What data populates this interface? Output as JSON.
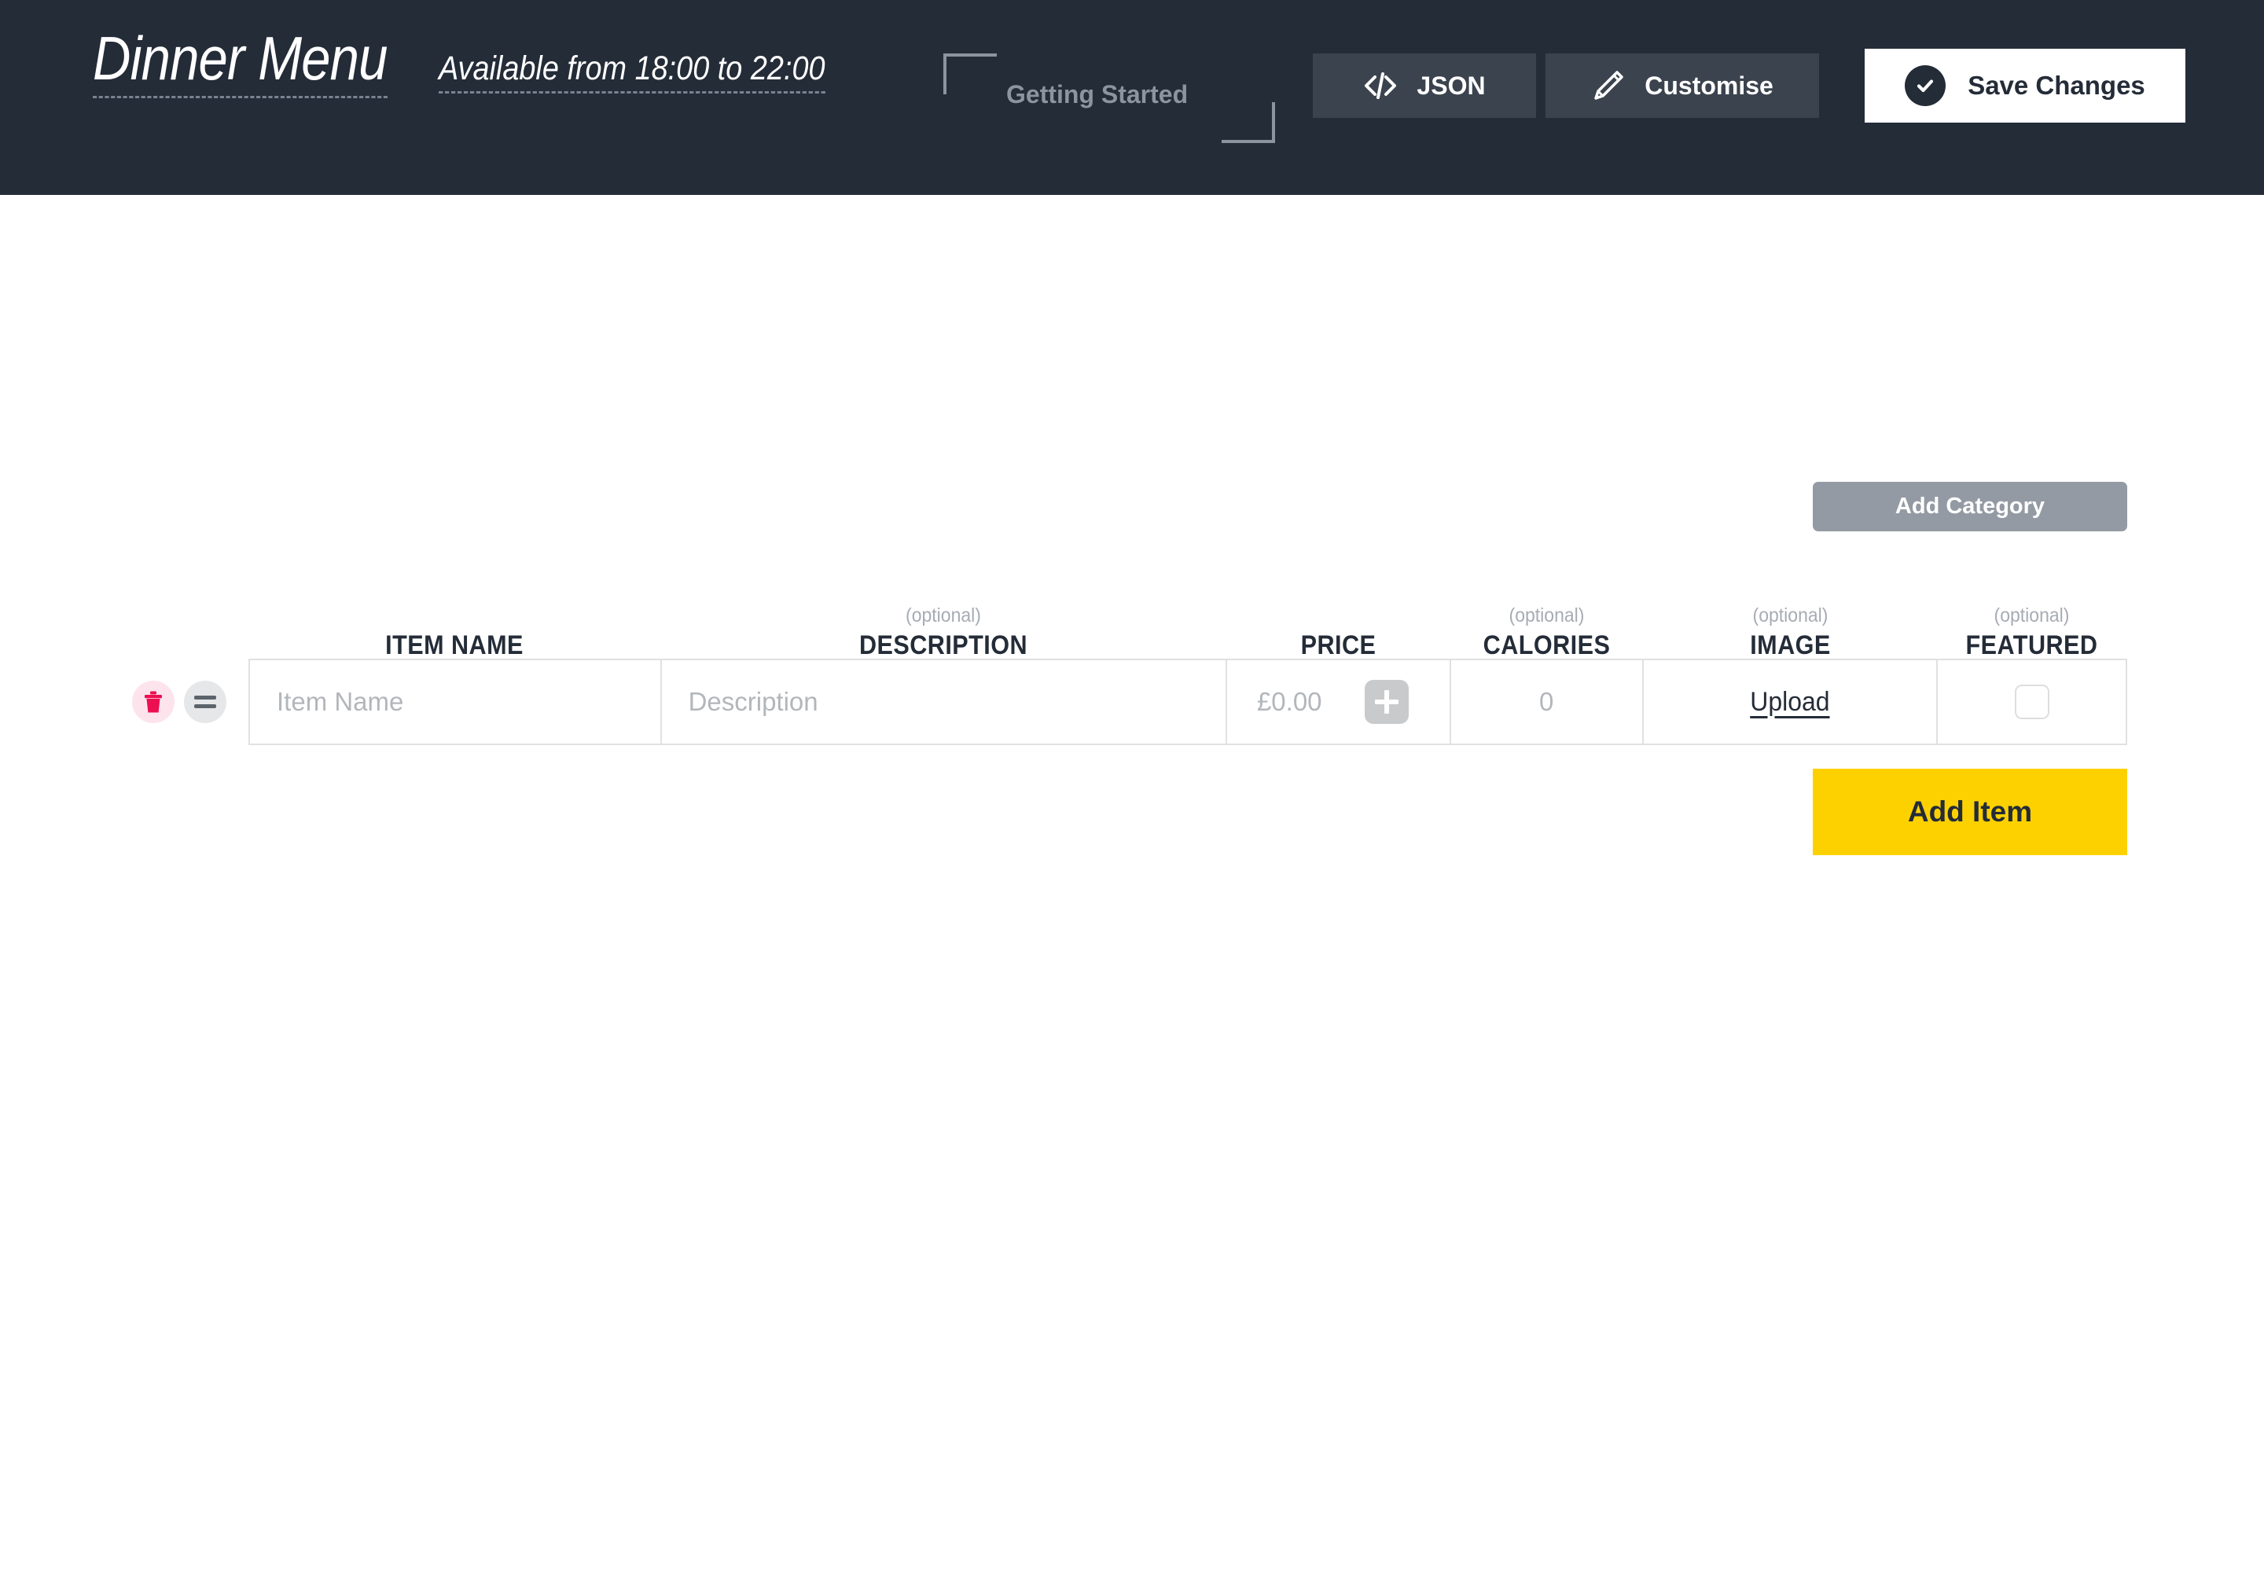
{
  "header": {
    "title": "Dinner Menu",
    "subtitle": "Available from 18:00 to 22:00",
    "getting_started_label": "Getting Started",
    "buttons": {
      "json": "JSON",
      "customise": "Customise",
      "save": "Save Changes"
    },
    "colors": {
      "background": "#242c38",
      "button_background": "#3b434e",
      "save_background": "#ffffff",
      "bracket": "#8c949f"
    }
  },
  "main": {
    "add_category_label": "Add Category",
    "add_item_label": "Add Item",
    "optional_tag": "(optional)",
    "columns": [
      {
        "label": "ITEM NAME",
        "optional": false
      },
      {
        "label": "DESCRIPTION",
        "optional": true
      },
      {
        "label": "PRICE",
        "optional": false
      },
      {
        "label": "CALORIES",
        "optional": true
      },
      {
        "label": "IMAGE",
        "optional": true
      },
      {
        "label": "FEATURED",
        "optional": true
      }
    ],
    "row": {
      "item_name_value": "",
      "item_name_placeholder": "Item Name",
      "description_value": "",
      "description_placeholder": "Description",
      "price_value": "",
      "price_placeholder": "£0.00",
      "calories_value": "",
      "calories_placeholder": "0",
      "upload_label": "Upload",
      "featured_checked": false
    },
    "colors": {
      "add_category": "#939aa3",
      "add_item": "#fdd100",
      "delete_circle": "#fde4ec",
      "delete_icon": "#ec0f51",
      "drag_circle": "#e6e7e9",
      "border": "#dfe1e3"
    }
  }
}
